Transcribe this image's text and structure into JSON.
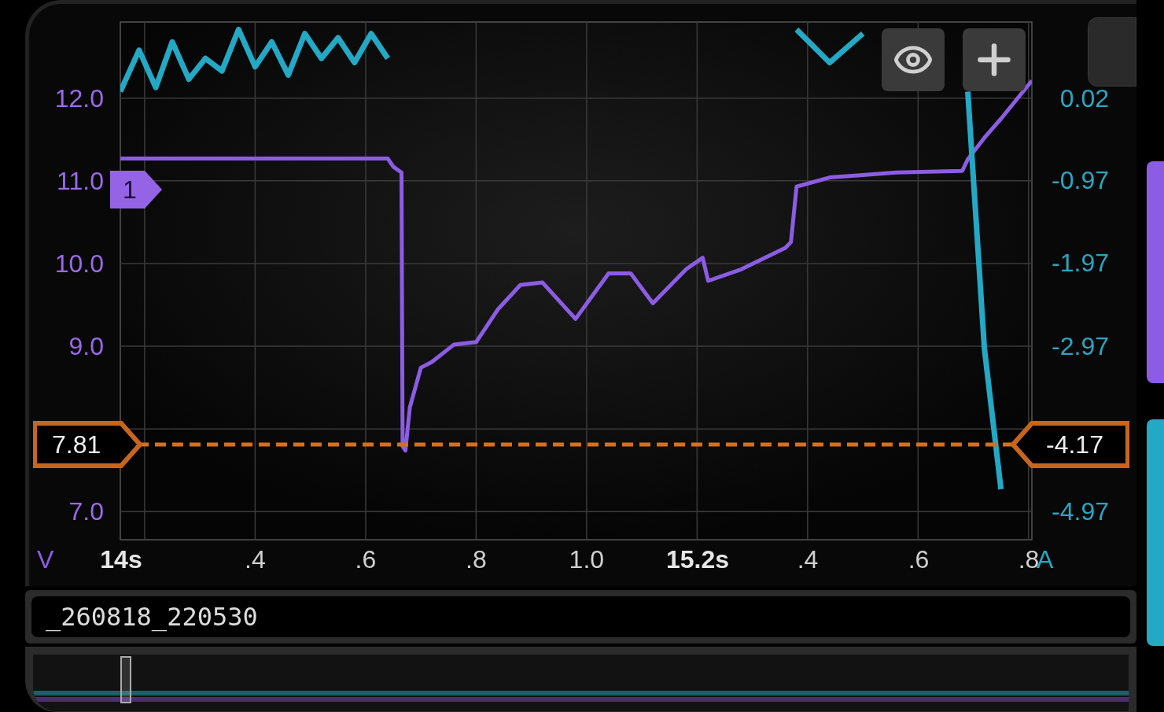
{
  "chart": {
    "chart_data": {
      "type": "line",
      "grid": true,
      "xlim": [
        0.156,
        1.806
      ],
      "ylim": [
        6.66,
        12.92
      ],
      "y2lim": [
        -5.31,
        0.94
      ],
      "xticks": [
        {
          "value": 0.4,
          "label": ".4"
        },
        {
          "value": 0.6,
          "label": ".6"
        },
        {
          "value": 0.8,
          "label": ".8"
        },
        {
          "value": 1.0,
          "label": "1.0"
        }
      ],
      "yticks": [
        {
          "value": 12,
          "label": "12.0"
        },
        {
          "value": 11,
          "label": "11.0"
        },
        {
          "value": 10,
          "label": "10.0"
        },
        {
          "value": 9,
          "label": "9.0"
        },
        {
          "value": 7,
          "label": "7.0"
        }
      ],
      "y2ticks": [
        {
          "value": 0.02,
          "label": "0.02"
        },
        {
          "value": -0.97,
          "label": "-0.97"
        },
        {
          "value": -1.97,
          "label": "-1.97"
        },
        {
          "value": -2.97,
          "label": "-2.97"
        },
        {
          "value": -4.97,
          "label": "-4.97"
        }
      ],
      "x": [
        0.156,
        0.19,
        0.22,
        0.25,
        0.28,
        0.31,
        0.34,
        0.37,
        0.4,
        0.43,
        0.46,
        0.49,
        0.52,
        0.55,
        0.58,
        0.61,
        0.64,
        0.65,
        0.665,
        0.667,
        0.672,
        0.68,
        0.7,
        0.72,
        0.76,
        0.8,
        0.84,
        0.88,
        0.92,
        0.98,
        1.04,
        1.08,
        1.12,
        1.18,
        1.21,
        1.22,
        1.28,
        1.36,
        1.37,
        1.38,
        1.44,
        1.5,
        1.56,
        1.62,
        1.68,
        1.69,
        1.72,
        1.75,
        1.806
      ],
      "series": [
        {
          "name": "V",
          "color": "#8d5ce4",
          "values": [
            11.27,
            11.27,
            11.27,
            11.27,
            11.27,
            11.27,
            11.27,
            11.27,
            11.27,
            11.27,
            11.27,
            11.27,
            11.27,
            11.27,
            11.27,
            11.27,
            11.27,
            11.17,
            11.1,
            7.79,
            7.74,
            8.26,
            8.74,
            8.81,
            9.02,
            9.05,
            9.45,
            9.74,
            9.77,
            9.33,
            9.88,
            9.88,
            9.52,
            9.93,
            10.07,
            9.79,
            9.93,
            10.19,
            10.26,
            10.93,
            11.04,
            11.07,
            11.1,
            11.11,
            11.12,
            11.26,
            11.52,
            11.75,
            12.21
          ]
        },
        {
          "name": "A",
          "color": "#23a9c6",
          "axis": "y2",
          "values": [
            0.1,
            0.6,
            0.15,
            0.7,
            0.25,
            0.5,
            0.35,
            0.85,
            0.4,
            0.7,
            0.3,
            0.8,
            0.5,
            0.75,
            0.45,
            0.8,
            0.5,
            null,
            null,
            null,
            null,
            null,
            null,
            null,
            null,
            null,
            null,
            null,
            null,
            null,
            null,
            null,
            null,
            null,
            null,
            null,
            null,
            null,
            null,
            0.85,
            0.45,
            0.8,
            null,
            null,
            null,
            0.1,
            -3.0,
            -4.7,
            null
          ]
        }
      ],
      "ref_lines": [
        {
          "axis": "y",
          "value": 7.81,
          "label": "7.81",
          "color": "#d4701f"
        }
      ]
    }
  },
  "time_labels": [
    {
      "text": "14s",
      "bold": true
    },
    {
      "text": "15.2s",
      "bold": true
    },
    {
      "text": ".4",
      "bold": false
    },
    {
      "text": ".6",
      "bold": false
    },
    {
      "text": ".8",
      "bold": false
    }
  ],
  "trace_marker": {
    "label": "1"
  },
  "cursor": {
    "right_reading": "-4.17"
  },
  "buttons": [
    {
      "kind": "eye"
    },
    {
      "kind": "add"
    }
  ],
  "file_name": "_260818_220530"
}
